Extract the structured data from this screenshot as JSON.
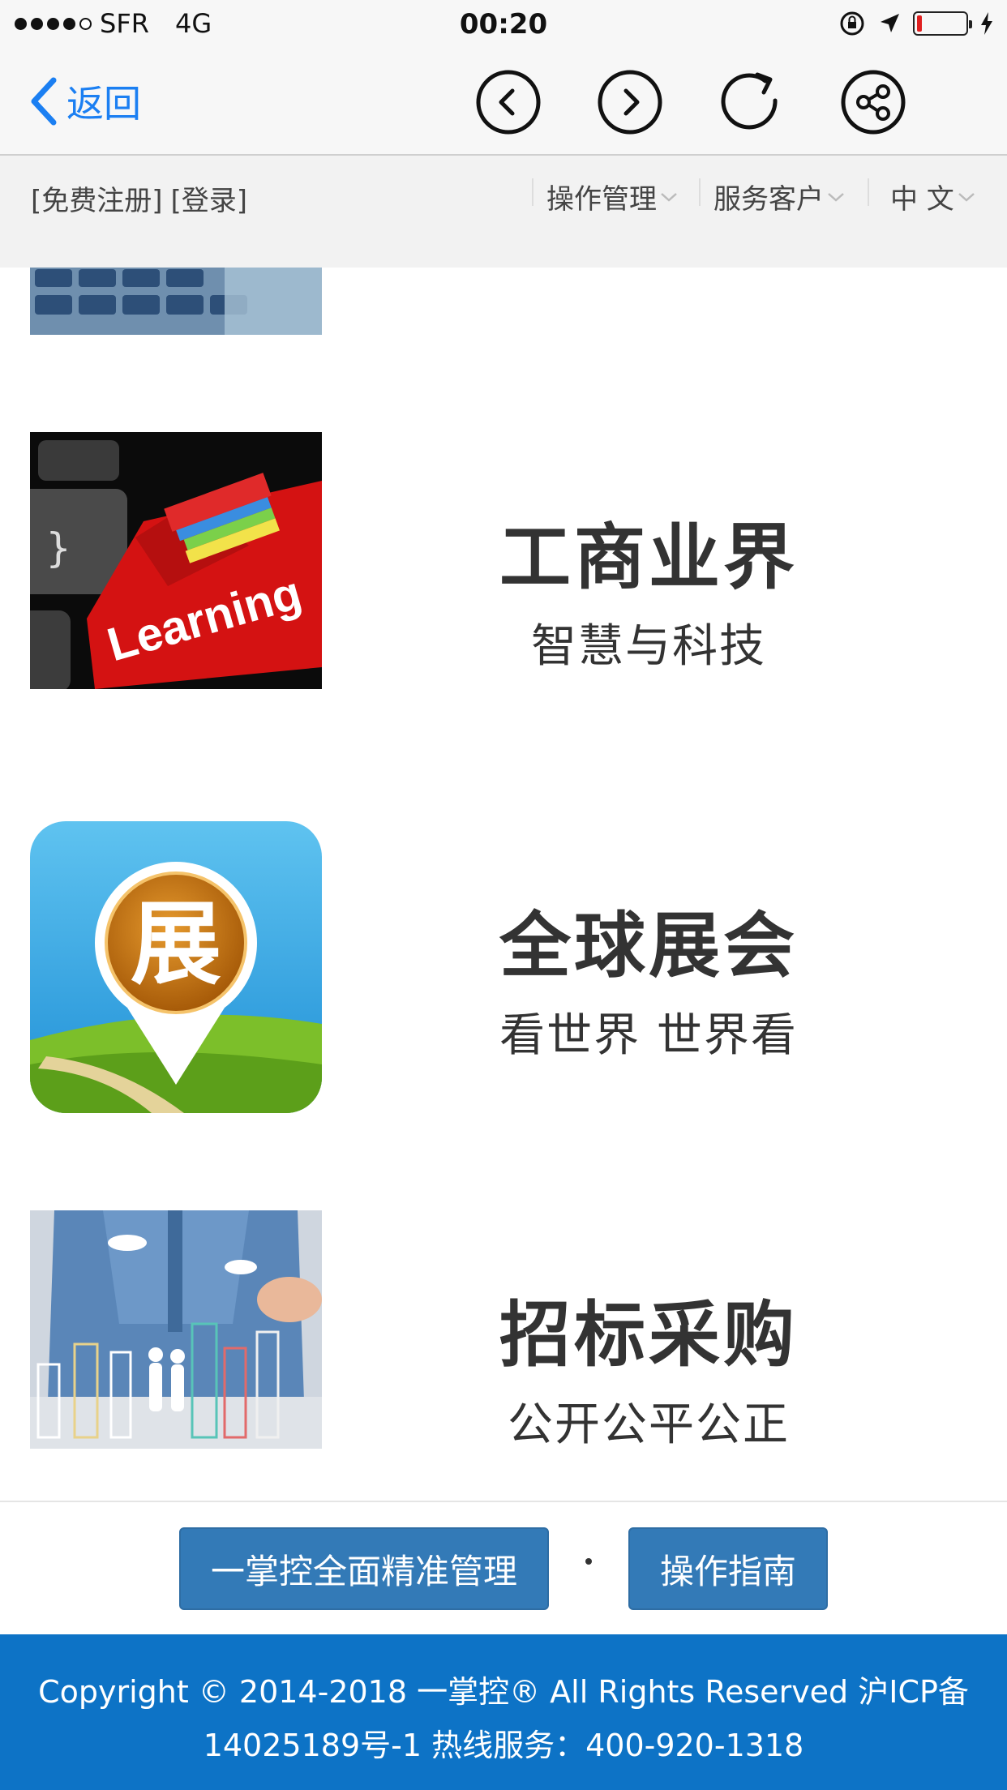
{
  "status_bar": {
    "carrier": "SFR",
    "network": "4G",
    "time": "00:20"
  },
  "nav": {
    "back_label": "返回"
  },
  "subheader": {
    "register": "[免费注册]",
    "login": "[登录]",
    "menu_operations": "操作管理",
    "menu_service": "服务客户",
    "menu_language": "中 文"
  },
  "items": [
    {
      "title": "工商业界",
      "subtitle": "智慧与科技"
    },
    {
      "title": "全球展会",
      "subtitle": "看世界 世界看"
    },
    {
      "title": "招标采购",
      "subtitle": "公开公平公正"
    }
  ],
  "buttons": {
    "primary": "一掌控全面精准管理",
    "guide": "操作指南"
  },
  "footer": {
    "line1": "Copyright © 2014-2018 一掌控® All Rights Reserved  沪ICP备",
    "line2": "14025189号-1 热线服务：400-920-1318"
  },
  "images": {
    "learning_text": "Learning",
    "expo_glyph": "展"
  },
  "colors": {
    "accent": "#1b7ff2",
    "button": "#337ab7",
    "footer": "#0d73c6"
  }
}
